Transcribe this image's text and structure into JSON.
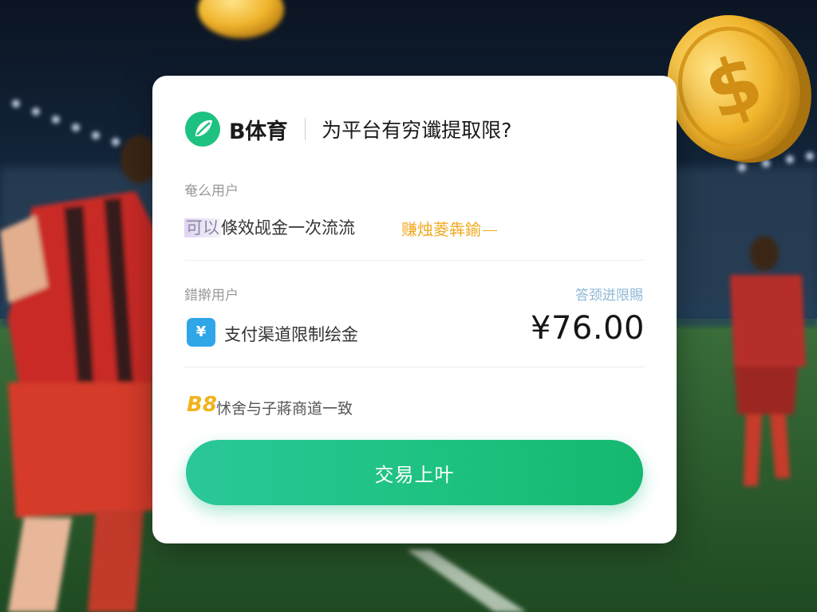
{
  "colors": {
    "brand_green": "#1ec280",
    "accent_orange": "#f0a91f",
    "pay_blue": "#2fa6e8",
    "link_blue": "#8fb8d6"
  },
  "header": {
    "logo_icon": "leaf-logo-icon",
    "brand": "B体育",
    "title": "为平台有穷谶提取限?"
  },
  "section_one": {
    "label": "奄么用户",
    "text_prefix": "可以",
    "text_main": "倏效觇金一次流流",
    "note": "赚烛菱犇鍮"
  },
  "section_two": {
    "label": "錯擀用户",
    "link": "答颈迸限賜",
    "pay_icon": "yen-payment-icon",
    "pay_symbol": "¥",
    "channel_text": "支付渠道限制绘金",
    "amount": "¥76.00"
  },
  "section_three": {
    "badge": "B8",
    "text": "怵舍与子蔣商道一致"
  },
  "cta": {
    "label": "交易上叶"
  }
}
